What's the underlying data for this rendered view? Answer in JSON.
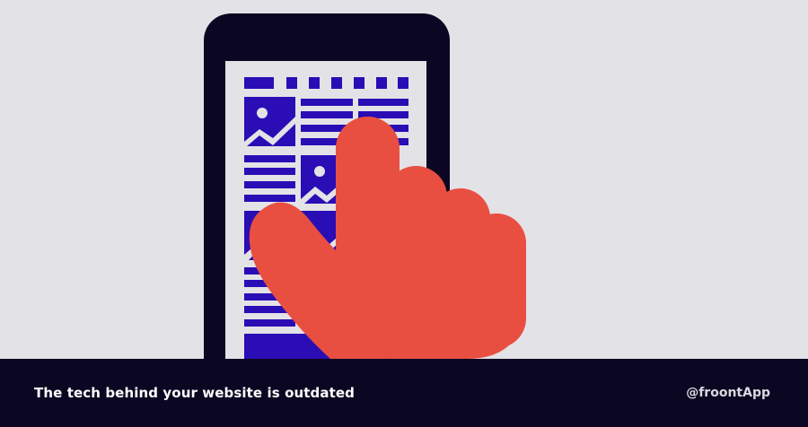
{
  "illustration": {
    "phone_frame_color": "#0b0722",
    "screen_color": "#e3e2e7",
    "content_color": "#2a0db5",
    "hand_color": "#e84f40",
    "icons": [
      "phone-icon",
      "image-placeholder-icon",
      "pointing-hand-icon"
    ]
  },
  "footer": {
    "caption": "The tech behind your website is outdated",
    "handle": "@froontApp",
    "background_color": "#0b0722"
  }
}
